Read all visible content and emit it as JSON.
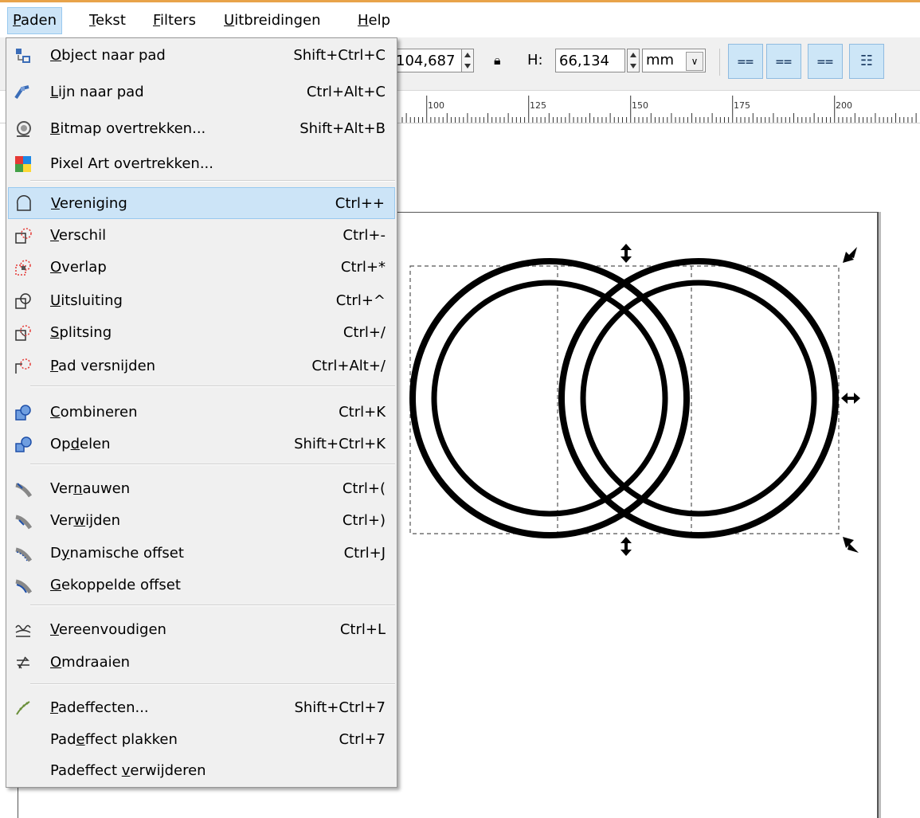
{
  "menubar": {
    "items": [
      {
        "pre": "",
        "u": "P",
        "post": "aden"
      },
      {
        "pre": "",
        "u": "T",
        "post": "ekst"
      },
      {
        "pre": "",
        "u": "F",
        "post": "ilters"
      },
      {
        "pre": "",
        "u": "U",
        "post": "itbreidingen"
      },
      {
        "pre": "",
        "u": "H",
        "post": "elp"
      }
    ]
  },
  "toolbar": {
    "w_value": "104,687",
    "h_label": "H:",
    "h_value": "66,134",
    "unit": "mm"
  },
  "ruler": {
    "labels": [
      "100",
      "125",
      "150",
      "175",
      "200"
    ]
  },
  "menu": {
    "items": [
      {
        "pre": "",
        "u": "O",
        "post": "bject naar pad",
        "shortcut": "Shift+Ctrl+C",
        "icon": "object-to-path-icon"
      },
      {
        "pre": "",
        "u": "L",
        "post": "ijn naar pad",
        "shortcut": "Ctrl+Alt+C",
        "icon": "stroke-to-path-icon"
      },
      {
        "pre": "",
        "u": "B",
        "post": "itmap overtrekken...",
        "shortcut": "Shift+Alt+B",
        "icon": "trace-bitmap-icon"
      },
      {
        "pre": "Pixel Art overtrekken...",
        "u": "",
        "post": "",
        "shortcut": "",
        "icon": "trace-pixel-art-icon"
      },
      {
        "pre": "",
        "u": "V",
        "post": "ereniging",
        "shortcut": "Ctrl++",
        "icon": "union-icon"
      },
      {
        "pre": "",
        "u": "V",
        "post": "erschil",
        "shortcut": "Ctrl+-",
        "icon": "difference-icon"
      },
      {
        "pre": "",
        "u": "O",
        "post": "verlap",
        "shortcut": "Ctrl+*",
        "icon": "intersection-icon"
      },
      {
        "pre": "",
        "u": "U",
        "post": "itsluiting",
        "shortcut": "Ctrl+^",
        "icon": "exclusion-icon"
      },
      {
        "pre": "",
        "u": "S",
        "post": "plitsing",
        "shortcut": "Ctrl+/",
        "icon": "division-icon"
      },
      {
        "pre": "",
        "u": "P",
        "post": "ad versnijden",
        "shortcut": "Ctrl+Alt+/",
        "icon": "cut-path-icon"
      },
      {
        "pre": "",
        "u": "C",
        "post": "ombineren",
        "shortcut": "Ctrl+K",
        "icon": "combine-icon"
      },
      {
        "pre": "Op",
        "u": "d",
        "post": "elen",
        "shortcut": "Shift+Ctrl+K",
        "icon": "break-apart-icon"
      },
      {
        "pre": "Ver",
        "u": "n",
        "post": "auwen",
        "shortcut": "Ctrl+(",
        "icon": "inset-icon"
      },
      {
        "pre": "Ver",
        "u": "w",
        "post": "ijden",
        "shortcut": "Ctrl+)",
        "icon": "outset-icon"
      },
      {
        "pre": "D",
        "u": "y",
        "post": "namische offset",
        "shortcut": "Ctrl+J",
        "icon": "dynamic-offset-icon"
      },
      {
        "pre": "",
        "u": "G",
        "post": "ekoppelde offset",
        "shortcut": "",
        "icon": "linked-offset-icon"
      },
      {
        "pre": "",
        "u": "V",
        "post": "ereenvoudigen",
        "shortcut": "Ctrl+L",
        "icon": "simplify-icon"
      },
      {
        "pre": "",
        "u": "O",
        "post": "mdraaien",
        "shortcut": "",
        "icon": "reverse-icon"
      },
      {
        "pre": "",
        "u": "P",
        "post": "adeffecten...",
        "shortcut": "Shift+Ctrl+7",
        "icon": "path-effects-icon"
      },
      {
        "pre": "Pad",
        "u": "e",
        "post": "ffect plakken",
        "shortcut": "Ctrl+7",
        "icon": ""
      },
      {
        "pre": "Padeffect ",
        "u": "v",
        "post": "erwijderen",
        "shortcut": "",
        "icon": ""
      }
    ]
  }
}
